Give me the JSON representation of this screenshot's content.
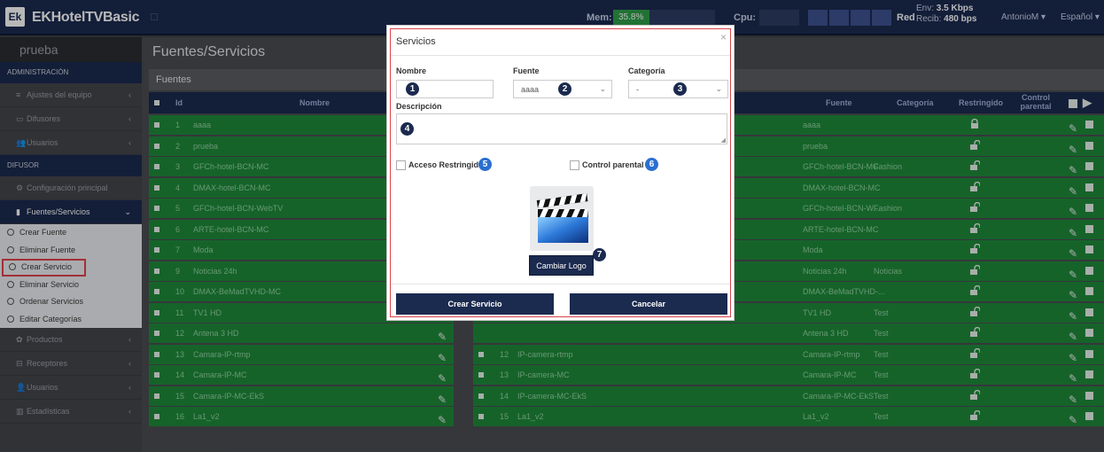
{
  "topbar": {
    "logo": "Ek",
    "title_prefix": "EK",
    "title_rest": "HotelTVBasic",
    "mem_label": "Mem:",
    "mem_value": "35.8%",
    "cpu_label": "Cpu:",
    "net_label": "Red",
    "env_label": "Env:",
    "env_value": "3.5 Kbps",
    "recib_label": "Recib:",
    "recib_value": "480 bps",
    "user": "AntonioM ▾",
    "lang": "Español ▾"
  },
  "sidebar": {
    "title": "prueba",
    "sections": [
      "ADMINISTRACIÓN",
      "DIFUSOR"
    ],
    "items_admin": [
      {
        "label": "Ajustes del equipo",
        "icon": "≡"
      },
      {
        "label": "Difusores",
        "icon": "▭"
      },
      {
        "label": "Usuarios",
        "icon": "👥"
      }
    ],
    "item_config": {
      "label": "Configuración principal",
      "icon": "⚙"
    },
    "item_fuentes": {
      "label": "Fuentes/Servicios",
      "icon": "▮"
    },
    "subitems": [
      "Crear Fuente",
      "Eliminar Fuente",
      "Crear Servicio",
      "Eliminar Servicio",
      "Ordenar Servicios",
      "Editar Categorías"
    ],
    "items_bottom": [
      {
        "label": "Productos",
        "icon": "✿"
      },
      {
        "label": "Receptores",
        "icon": "⊟"
      },
      {
        "label": "Usuarios",
        "icon": "👤"
      },
      {
        "label": "Estadísticas",
        "icon": "▥"
      }
    ]
  },
  "main": {
    "title": "Fuentes/Servicios",
    "panel": "Fuentes",
    "left_headers": {
      "id": "Id",
      "name": "Nombre"
    },
    "right_headers": {
      "fuente": "Fuente",
      "categoria": "Categoría",
      "restringido": "Restringido",
      "control": "Control parental"
    },
    "left_rows": [
      {
        "id": "1",
        "name": "aaaa"
      },
      {
        "id": "2",
        "name": "prueba"
      },
      {
        "id": "3",
        "name": "GFCh-hotel-BCN-MC"
      },
      {
        "id": "4",
        "name": "DMAX-hotel-BCN-MC"
      },
      {
        "id": "5",
        "name": "GFCh-hotel-BCN-WebTV"
      },
      {
        "id": "6",
        "name": "ARTE-hotel-BCN-MC"
      },
      {
        "id": "7",
        "name": "Moda"
      },
      {
        "id": "9",
        "name": "Noticias 24h"
      },
      {
        "id": "10",
        "name": "DMAX-BeMadTVHD-MC"
      },
      {
        "id": "11",
        "name": "TV1 HD"
      },
      {
        "id": "12",
        "name": "Antena 3 HD"
      },
      {
        "id": "13",
        "name": "Camara-IP-rtmp"
      },
      {
        "id": "14",
        "name": "Camara-IP-MC"
      },
      {
        "id": "15",
        "name": "Camara-IP-MC-EkS"
      },
      {
        "id": "16",
        "name": "La1_v2"
      }
    ],
    "right_rows": [
      {
        "id": "",
        "name": "",
        "fuente": "aaaa",
        "cat": "",
        "locked": true
      },
      {
        "id": "",
        "name": "",
        "fuente": "prueba",
        "cat": "",
        "locked": false
      },
      {
        "id": "",
        "name": "",
        "fuente": "GFCh-hotel-BCN-MC",
        "cat": "Fashion",
        "locked": false
      },
      {
        "id": "",
        "name": "",
        "fuente": "DMAX-hotel-BCN-MC",
        "cat": "",
        "locked": false
      },
      {
        "id": "",
        "name": "",
        "fuente": "GFCh-hotel-BCN-W...",
        "cat": "Fashion",
        "locked": false
      },
      {
        "id": "",
        "name": "",
        "fuente": "ARTE-hotel-BCN-MC",
        "cat": "",
        "locked": false
      },
      {
        "id": "",
        "name": "",
        "fuente": "Moda",
        "cat": "",
        "locked": false
      },
      {
        "id": "",
        "name": "",
        "fuente": "Noticias 24h",
        "cat": "Noticias",
        "locked": false
      },
      {
        "id": "",
        "name": "",
        "fuente": "DMAX-BeMadTVHD-...",
        "cat": "",
        "locked": false
      },
      {
        "id": "",
        "name": "",
        "fuente": "TV1 HD",
        "cat": "Test",
        "locked": false
      },
      {
        "id": "",
        "name": "",
        "fuente": "Antena 3 HD",
        "cat": "Test",
        "locked": false
      },
      {
        "id": "12",
        "name": "IP-camera-rtmp",
        "fuente": "Camara-IP-rtmp",
        "cat": "Test",
        "locked": false
      },
      {
        "id": "13",
        "name": "IP-camera-MC",
        "fuente": "Camara-IP-MC",
        "cat": "Test",
        "locked": false
      },
      {
        "id": "14",
        "name": "IP-camera-MC-EkS",
        "fuente": "Camara-IP-MC-EkS",
        "cat": "Test",
        "locked": false
      },
      {
        "id": "15",
        "name": "La1_v2",
        "fuente": "La1_v2",
        "cat": "Test",
        "locked": false
      }
    ]
  },
  "modal": {
    "title": "Servicios",
    "close": "×",
    "nombre_label": "Nombre",
    "fuente_label": "Fuente",
    "categoria_label": "Categoría",
    "descripcion_label": "Descripción",
    "fuente_value": "aaaa",
    "categoria_value": "-",
    "acceso_label": "Acceso Restringido",
    "control_label": "Control parental",
    "logo_button": "Cambiar Logo",
    "create_button": "Crear Servicio",
    "cancel_button": "Cancelar",
    "badges": [
      "1",
      "2",
      "3",
      "4",
      "5",
      "6",
      "7"
    ]
  }
}
